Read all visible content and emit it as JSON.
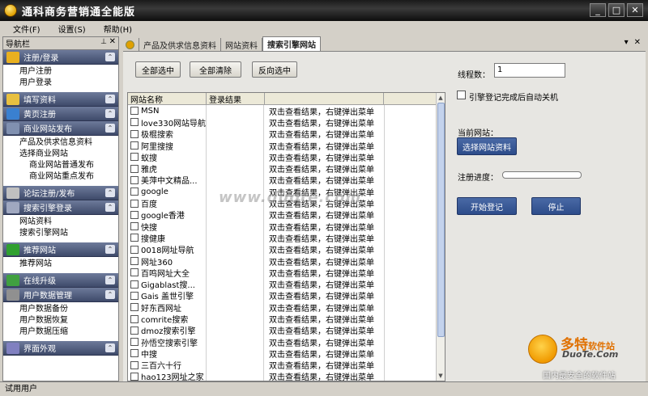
{
  "window": {
    "title": "通科商务营销通全能版"
  },
  "menu": [
    "文件(F)",
    "设置(S)",
    "帮助(H)"
  ],
  "sidebar": {
    "title": "导航栏",
    "sections": [
      {
        "label": "注册/登录",
        "icon": "key-icon",
        "color": "#e8b020",
        "items": [
          {
            "label": "用户注册"
          },
          {
            "label": "用户登录"
          }
        ]
      },
      {
        "label": "填写资料",
        "icon": "folder-icon",
        "color": "#e8c040",
        "items": []
      },
      {
        "label": "黄页注册",
        "icon": "globe-icon",
        "color": "#3a80d0",
        "items": []
      },
      {
        "label": "商业网站发布",
        "icon": "pages-icon",
        "color": "#8090b0",
        "items": [
          {
            "label": "产品及供求信息资料"
          },
          {
            "label": "选择商业网站"
          },
          {
            "label": "商业网站普通发布",
            "level": 2
          },
          {
            "label": "商业网站重点发布",
            "level": 2
          }
        ]
      },
      {
        "label": "论坛注册/发布",
        "icon": "chat-icon",
        "color": "#c0c0c0",
        "items": []
      },
      {
        "label": "搜索引擎登录",
        "icon": "window-icon",
        "color": "#a0a8c0",
        "items": [
          {
            "label": "网站资料"
          },
          {
            "label": "搜索引擎网站"
          }
        ]
      },
      {
        "label": "推荐网站",
        "icon": "check-icon",
        "color": "#30a030",
        "items": [
          {
            "label": "推荐网站"
          }
        ]
      },
      {
        "label": "在线升级",
        "icon": "update-icon",
        "color": "#40a040",
        "items": []
      },
      {
        "label": "用户数据管理",
        "icon": "disk-icon",
        "color": "#909090",
        "items": [
          {
            "label": "用户数据备份"
          },
          {
            "label": "用户数据恢复"
          },
          {
            "label": "用户数据压缩"
          }
        ]
      },
      {
        "label": "界面外观",
        "icon": "palette-icon",
        "color": "#8080c0",
        "items": []
      }
    ]
  },
  "tabs": [
    {
      "label": "产品及供求信息资料",
      "active": false
    },
    {
      "label": "网站资料",
      "active": false
    },
    {
      "label": "搜索引擎网站",
      "active": true
    }
  ],
  "toolbar": {
    "select_all": "全部选中",
    "clear_all": "全部清除",
    "invert": "反向选中"
  },
  "table": {
    "columns": [
      "网站名称",
      "登录结果"
    ],
    "hint": "双击查看结果，右键弹出菜单",
    "rows": [
      "MSN",
      "love330网站导航",
      "极棍搜索",
      "阿里搜搜",
      "蚁搜",
      "雅虎",
      "美萍中文精品...",
      "google",
      "百度",
      "google香港",
      "快搜",
      "搜健康",
      "0018网址导航",
      "网址360",
      "百鸣网址大全",
      "Gigablast搜...",
      "Gais 盖世引擎",
      "好东西网址",
      "comrite搜索",
      "dmoz搜索引擎",
      "孙悟空搜索引擎",
      "中搜",
      "三百六十行",
      "hao123网址之家",
      "商道网"
    ]
  },
  "right": {
    "threads_label": "线程数：",
    "threads_value": "1",
    "auto_shutdown_label": "引擎登记完成后自动关机",
    "current_site_label": "当前网站：",
    "choose_site_button": "选择网站资料",
    "progress_label": "注册进度：",
    "progress": 0,
    "start_button": "开始登记",
    "stop_button": "停止"
  },
  "status": "试用用户",
  "watermarks": {
    "center": "www.duote.com",
    "brand_cn": "多特",
    "brand_tag": "软件站",
    "brand_en": "DuoTe.Com",
    "slogan": "国内最安全的软件站"
  }
}
